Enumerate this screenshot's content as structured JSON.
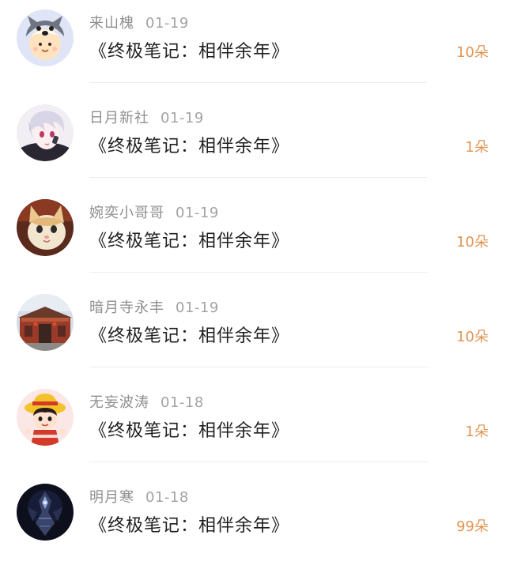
{
  "colors": {
    "name_text": "#8f8f8f",
    "title_text": "#1f1f1f",
    "count_text": "#e19552",
    "divider": "#ededed"
  },
  "items": [
    {
      "name": "来山槐",
      "date": "01-19",
      "title": "《终极笔记：相伴余年》",
      "count": "10朵",
      "avatar_icon": "cartoon-husky-hat-avatar"
    },
    {
      "name": "日月新社",
      "date": "01-19",
      "title": "《终极笔记：相伴余年》",
      "count": "1朵",
      "avatar_icon": "anime-white-hair-boy-avatar"
    },
    {
      "name": "婉奕小哥哥",
      "date": "01-19",
      "title": "《终极笔记：相伴余年》",
      "count": "10朵",
      "avatar_icon": "cat-photo-avatar"
    },
    {
      "name": "暗月寺永丰",
      "date": "01-19",
      "title": "《终极笔记：相伴余年》",
      "count": "10朵",
      "avatar_icon": "temple-building-avatar"
    },
    {
      "name": "无妄波涛",
      "date": "01-18",
      "title": "《终极笔记：相伴余年》",
      "count": "1朵",
      "avatar_icon": "cartoon-straw-hat-girl-avatar"
    },
    {
      "name": "明月寒",
      "date": "01-18",
      "title": "《终极笔记：相伴余年》",
      "count": "99朵",
      "avatar_icon": "dark-armor-figure-avatar"
    }
  ]
}
